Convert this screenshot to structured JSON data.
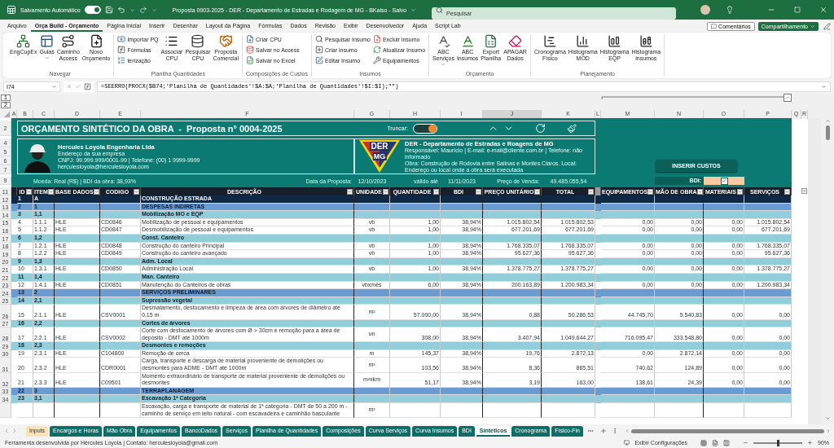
{
  "titlebar": {
    "autosave": {
      "label": "Salvamento Automático",
      "on": true
    },
    "title": "Proposta 0003-2025 - DER - Departamento de Estradas e Rodagem de MG - BKaiso - Salvo",
    "search": {
      "placeholder": "Pesquisar"
    }
  },
  "menu": {
    "tabs": [
      {
        "label": "Arquivo",
        "selected": false
      },
      {
        "label": "Orça Build - Orçamento",
        "selected": true
      },
      {
        "label": "Página Inicial",
        "selected": false
      },
      {
        "label": "Inserir",
        "selected": false
      },
      {
        "label": "Desenhar",
        "selected": false
      },
      {
        "label": "Layout da Página",
        "selected": false
      },
      {
        "label": "Fórmulas",
        "selected": false
      },
      {
        "label": "Dados",
        "selected": false
      },
      {
        "label": "Revisão",
        "selected": false
      },
      {
        "label": "Exibir",
        "selected": false
      },
      {
        "label": "Desenvolvedor",
        "selected": false
      },
      {
        "label": "Ajuda",
        "selected": false
      },
      {
        "label": "Script Lab",
        "selected": false
      }
    ],
    "comments": "Comentários",
    "share": "Compartilhamento"
  },
  "ribbon": {
    "groups": [
      {
        "label": "Navegar",
        "items": [
          {
            "label": "EngCupEx",
            "kind": "large",
            "dropdown": false
          },
          {
            "label": "Guias",
            "kind": "large",
            "dropdown": true
          },
          {
            "label": "Caminho Access",
            "kind": "large",
            "dropdown": false
          },
          {
            "label": "Novo Orçamento",
            "kind": "large",
            "dropdown": false
          }
        ]
      },
      {
        "label": "Planilha Quantidades",
        "items": [
          {
            "label": "Importar PQ",
            "kind": "small",
            "dropdown": false
          },
          {
            "label": "Fórmulas",
            "kind": "small",
            "dropdown": false
          },
          {
            "label": "terização",
            "kind": "small",
            "dropdown": false
          },
          {
            "label": "Associar CPU",
            "kind": "large",
            "dropdown": false
          },
          {
            "label": "Pesquisar CPU",
            "kind": "large",
            "dropdown": false
          },
          {
            "label": "Proposta Comercial",
            "kind": "large",
            "dropdown": false
          }
        ]
      },
      {
        "label": "Composições de Custos",
        "items": [
          {
            "label": "Criar CPU",
            "kind": "small",
            "dropdown": false
          },
          {
            "label": "Salvar no Access",
            "kind": "small",
            "dropdown": false
          },
          {
            "label": "Salvar no Excel",
            "kind": "small",
            "dropdown": false
          }
        ]
      },
      {
        "label": "Insumos",
        "items": [
          {
            "label": "Pesquisar Insumo",
            "kind": "small",
            "dropdown": false
          },
          {
            "label": "Criar insumo",
            "kind": "small",
            "dropdown": false
          },
          {
            "label": "Editar Insumo",
            "kind": "small",
            "dropdown": false
          },
          {
            "label": "Excluir insumo",
            "kind": "small",
            "dropdown": false
          },
          {
            "label": "Atualizar Insumo",
            "kind": "small",
            "dropdown": false
          },
          {
            "label": "Equipamentos",
            "kind": "small",
            "dropdown": false
          }
        ]
      },
      {
        "label": "Orçamento",
        "items": [
          {
            "label": "ABC Serviços",
            "kind": "large",
            "dropdown": true
          },
          {
            "label": "ABC Insumos",
            "kind": "large",
            "dropdown": false
          },
          {
            "label": "Export Planilha",
            "kind": "large",
            "dropdown": false
          },
          {
            "label": "APAGAR Dados",
            "kind": "large",
            "dropdown": false
          }
        ]
      },
      {
        "label": "Planejamento",
        "items": [
          {
            "label": "Cronograma Físico",
            "kind": "large",
            "dropdown": false
          },
          {
            "label": "Histograma MOD",
            "kind": "large",
            "dropdown": false
          },
          {
            "label": "Histograma EQP",
            "kind": "large",
            "dropdown": false
          },
          {
            "label": "Histograma insumos",
            "kind": "large",
            "dropdown": false
          }
        ]
      }
    ]
  },
  "formula_bar": {
    "name_box": "I74",
    "formula": "=SEERRO(PROCX($B74;'Planilha de Quantidades'!$A:$A;'Planilha de Quantidades'!$I:$I);\"\")"
  },
  "outline_levels": [
    "1",
    "2"
  ],
  "columns": [
    {
      "label": "A",
      "selected": false
    },
    {
      "label": "B",
      "selected": false
    },
    {
      "label": "C",
      "selected": false
    },
    {
      "label": "D",
      "selected": false
    },
    {
      "label": "E",
      "selected": false
    },
    {
      "label": "F",
      "selected": false
    },
    {
      "label": "G",
      "selected": false
    },
    {
      "label": "H",
      "selected": false
    },
    {
      "label": "I",
      "selected": false
    },
    {
      "label": "J",
      "selected": true
    },
    {
      "label": "K",
      "selected": false
    },
    {
      "label": "L",
      "selected": false
    },
    {
      "label": "M",
      "selected": false
    },
    {
      "label": "N",
      "selected": false
    },
    {
      "label": "O",
      "selected": false
    },
    {
      "label": "P",
      "selected": false
    },
    {
      "label": "Q",
      "selected": false
    },
    {
      "label": "R",
      "selected": false
    }
  ],
  "banner": {
    "row_numbers": [
      "2",
      "4",
      "5",
      "6",
      "7",
      "9"
    ],
    "title": "ORÇAMENTO SINTÉTICO DA OBRA  -  Proposta n° 0004-2025",
    "truncate": {
      "label": "Truncar:",
      "on": true
    },
    "company": {
      "name": "Hercules Loyola Engenharia Ltda",
      "address": "Endereço da sua empresa",
      "cnpj": "CNPJ: 99.999.999/0001-99 | Telefone: (00) 1 9999-9999",
      "email": "herculesloyola@herculesloyola.com"
    },
    "client": {
      "logo": [
        "DER",
        "MG"
      ],
      "name": "DER - Departamento de Estradas e Roagens de MG",
      "contact": "Responsável: Maurício | E-mail: e-mail@cliente.com.br | Telefone: não informado",
      "work": "Obra: Construção de Rodovia entre Salinas e Montes Claros. Local: Endereço ou local onde a obra será executada"
    },
    "insert_button": "INSERIR CUSTOS",
    "info": {
      "currency": "Moeda: Real (R$) | BDI da obra: 38,93%",
      "date_label": "Data da Proposta:",
      "date": "12/10/2023",
      "valid_label": "válido até",
      "valid_until": "11/11/2023",
      "price_label": "Preço de Venda:",
      "price": "49.485.055,54"
    },
    "bdi": {
      "label": "BDI:",
      "checked": true
    }
  },
  "table": {
    "header_row": "11",
    "columns": [
      "ID",
      "ITEM",
      "BASE DADOS",
      "CODIGO",
      "DESCRIÇÃO",
      "UNIDADE",
      "QUANTIDADE",
      "BDI",
      "PREÇO UNITÁRIO",
      "TOTAL",
      "EQUIPAMENTOS",
      "MÃO DE OBRA",
      "MATERIAIS",
      "SERVIÇOS"
    ],
    "rows": [
      {
        "row": "12",
        "kind": "group1",
        "id": "1",
        "item": "A",
        "desc": "CONSTRUÇÃO ESTRADA"
      },
      {
        "row": "13",
        "kind": "group2",
        "id": "2",
        "item": "1",
        "desc": "DESPESAS INDIRETAS"
      },
      {
        "row": "14",
        "kind": "group3",
        "id": "3",
        "item": "1,1",
        "desc": "Mobilização MO e EQP"
      },
      {
        "row": "15",
        "kind": "item",
        "id": "4",
        "item": "1.1.1",
        "base": "HLE",
        "code": "CD0846",
        "desc": "Mobilização de pessoal e equipamentos",
        "unit": "vb",
        "qty": "1,00",
        "bdi": "38,94%",
        "price": "1.015.802,54",
        "total": "1.015.802,53",
        "equip": "0,00",
        "labor": "0,00",
        "mat": "0,00",
        "serv": "1.015.802,54"
      },
      {
        "row": "16",
        "kind": "item",
        "id": "5",
        "item": "1.1.2",
        "base": "HLE",
        "code": "CD0847",
        "desc": "Desmobilização de pessoal e equipamentos",
        "unit": "vb",
        "qty": "1,00",
        "bdi": "38,94%",
        "price": "677.201,69",
        "total": "677.201,69",
        "equip": "0,00",
        "labor": "0,00",
        "mat": "0,00",
        "serv": "677.201,69"
      },
      {
        "row": "17",
        "kind": "group3",
        "id": "6",
        "item": "1,2",
        "desc": "Const. Canteiro"
      },
      {
        "row": "18",
        "kind": "item",
        "id": "7",
        "item": "1.2.1",
        "base": "HLE",
        "code": "CD0848",
        "desc": "Construção do canteiro Principal",
        "unit": "vb",
        "qty": "1,00",
        "bdi": "38,94%",
        "price": "1.768.335,07",
        "total": "1.768.335,07",
        "equip": "0,00",
        "labor": "0,00",
        "mat": "0,00",
        "serv": "1.768.335,07"
      },
      {
        "row": "19",
        "kind": "item",
        "id": "8",
        "item": "1.2.2",
        "base": "HLE",
        "code": "CD0849",
        "desc": "Construção do canteiro avançado",
        "unit": "vb",
        "qty": "1,00",
        "bdi": "38,94%",
        "price": "95.627,36",
        "total": "95.627,36",
        "equip": "0,00",
        "labor": "0,00",
        "mat": "0,00",
        "serv": "95.627,36"
      },
      {
        "row": "20",
        "kind": "group3",
        "id": "9",
        "item": "1,3",
        "desc": "Adm. Local"
      },
      {
        "row": "21",
        "kind": "item",
        "id": "10",
        "item": "1.3.1",
        "base": "HLE",
        "code": "CD0850",
        "desc": "Administração Local",
        "unit": "vb",
        "qty": "1,00",
        "bdi": "38,94%",
        "price": "1.378.775,27",
        "total": "1.378.775,27",
        "equip": "0,00",
        "labor": "0,00",
        "mat": "0,00",
        "serv": "1.378.775,27"
      },
      {
        "row": "22",
        "kind": "group3",
        "id": "11",
        "item": "1,4",
        "desc": "Man. Canteiro"
      },
      {
        "row": "23",
        "kind": "item",
        "id": "12",
        "item": "1.4.1",
        "base": "HLE",
        "code": "CD0851",
        "desc": "Manutenção do Canteiros de obras",
        "unit": "vbxmês",
        "qty": "6,00",
        "bdi": "38,94%",
        "price": "200.163,89",
        "total": "1.200.983,34",
        "equip": "0,00",
        "labor": "0,00",
        "mat": "0,00",
        "serv": "1.200.983,34"
      },
      {
        "row": "24",
        "kind": "group2",
        "id": "13",
        "item": "2",
        "desc": "SERVIÇOS PRELIMINARES"
      },
      {
        "row": "25",
        "kind": "group3",
        "id": "14",
        "item": "2,1",
        "desc": "Supressão vegetal"
      },
      {
        "row": "26",
        "kind": "item",
        "id": "15",
        "item": "2.1.1",
        "base": "HLE",
        "code": "CSV0001",
        "desc": "Desmatamento, destocamento e limpeza de área com árvores de diâmetro até 0,15 m",
        "unit": "m²",
        "qty": "57.000,00",
        "bdi": "38,94%",
        "price": "0,88",
        "total": "50.286,53",
        "equip": "44.745,70",
        "labor": "5.540,83",
        "mat": "0,00",
        "serv": "0,00"
      },
      {
        "row": "27",
        "kind": "group3",
        "id": "16",
        "item": "2,2",
        "desc": "Cortes de árvores"
      },
      {
        "row": "28",
        "kind": "item",
        "id": "17",
        "item": "2.2.1",
        "base": "HLE",
        "code": "CSV0002",
        "desc": "Corte com destocamento de árvores com Ø > 30cm e remoção para a área de depósito - DMT até 1000m",
        "unit": "un",
        "qty": "308,00",
        "bdi": "38,94%",
        "price": "3.407,94",
        "total": "1.049.644,27",
        "equip": "716.095,47",
        "labor": "333.548,80",
        "mat": "0,00",
        "serv": "0,00"
      },
      {
        "row": "29",
        "kind": "group3",
        "id": "18",
        "item": "2,3",
        "desc": "Desmontes e remoções"
      },
      {
        "row": "30",
        "kind": "item",
        "id": "19",
        "item": "2.3.1",
        "base": "HLE",
        "code": "C104800",
        "desc": "Remoção de cerca",
        "unit": "m",
        "qty": "145,37",
        "bdi": "38,94%",
        "price": "19,76",
        "total": "2.872,13",
        "equip": "0,00",
        "labor": "2.872,14",
        "mat": "0,00",
        "serv": "0,00"
      },
      {
        "row": "31",
        "kind": "item",
        "id": "20",
        "item": "2.3.2",
        "base": "HLE",
        "code": "CDR0001",
        "desc": "Carga, transporte e descarga de material proveniente de demolições ou desmontes para ADME - DMT até 1000m",
        "unit": "m³",
        "qty": "103,56",
        "bdi": "38,94%",
        "price": "8,36",
        "total": "865,51",
        "equip": "740,62",
        "labor": "124,89",
        "mat": "0,00",
        "serv": "0,00"
      },
      {
        "row": "32",
        "kind": "item",
        "id": "21",
        "item": "2.3.3",
        "base": "HLE",
        "code": "C09501",
        "desc": "Momento extraordinário de transporte de material proveniente de demolições ou desmontes",
        "unit": "m³xkm",
        "qty": "51,17",
        "bdi": "38,94%",
        "price": "3,19",
        "total": "163,00",
        "equip": "138,61",
        "labor": "24,39",
        "mat": "0,00",
        "serv": "0,00"
      },
      {
        "row": "33",
        "kind": "group2",
        "id": "22",
        "item": "3",
        "desc": "TERRAPLANAGEM"
      },
      {
        "row": "34",
        "kind": "group3",
        "id": "23",
        "item": "3,1",
        "desc": "Escavação 1ª Categoria"
      },
      {
        "kind": "item",
        "desc": "Escavação, carga e transporte de material de 1ª categoria - DMT de 50 a 200 m - caminho de serviço em leito natural - com escavadeira e caminhão basculante",
        "unit": "m³"
      }
    ]
  },
  "sheet_tabs": [
    {
      "label": "Inputs",
      "color": "#fbe3b5",
      "selected": false
    },
    {
      "label": "Encargos e Horas",
      "color": "#0b6e69",
      "selected": false
    },
    {
      "label": "Mão Obra",
      "color": "#0b6e69",
      "selected": false
    },
    {
      "label": "Equipamentos",
      "color": "#0b6e69",
      "selected": false
    },
    {
      "label": "BancoDados",
      "color": "#0b6e69",
      "selected": false
    },
    {
      "label": "Serviços",
      "color": "#0b6e69",
      "selected": false
    },
    {
      "label": "Planilha de Quantidades",
      "color": "#0b6e69",
      "selected": false
    },
    {
      "label": "Composições",
      "color": "#0b6e69",
      "selected": false
    },
    {
      "label": "Curva Serviços",
      "color": "#0b6e69",
      "selected": false
    },
    {
      "label": "Curva Insumos",
      "color": "#0b6e69",
      "selected": false
    },
    {
      "label": "BDI",
      "color": "#0b6e69",
      "selected": false
    },
    {
      "label": "Sinteticos",
      "color": "#0b6e69",
      "selected": true
    },
    {
      "label": "Cronograma",
      "color": "#0b6e69",
      "selected": false
    },
    {
      "label": "Físico-Fin",
      "color": "#0b6e69",
      "selected": false
    }
  ],
  "status_bar": {
    "text": "Ferramenta desenvolvida por Hércules Loyola | Contato: herculesloyola@gmail.com",
    "settings": "Exibir Configurações",
    "zoom": {
      "level": 0.5,
      "label": "90%"
    }
  }
}
